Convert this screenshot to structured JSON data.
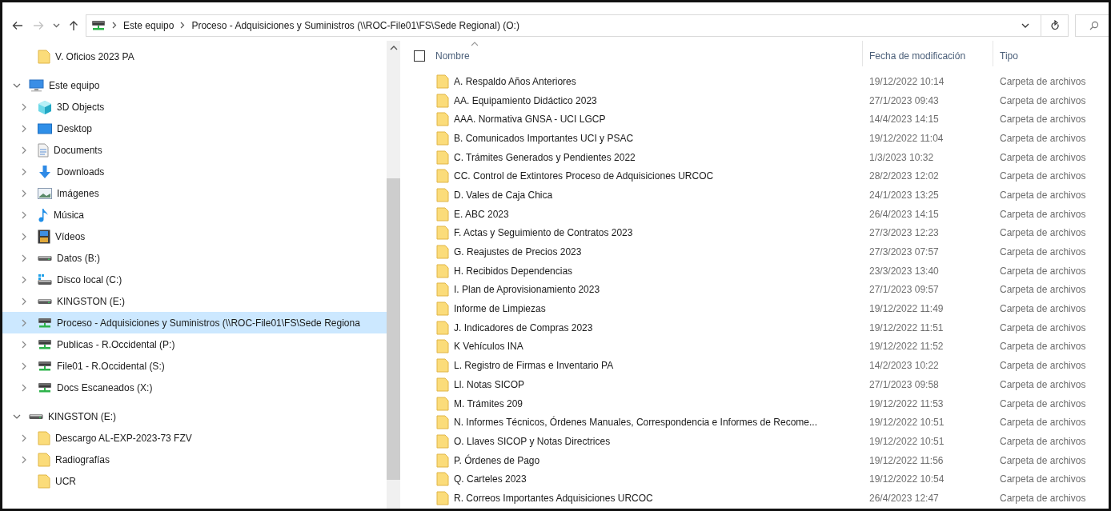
{
  "nav_buttons": [
    {
      "kind": "back",
      "disabled": false
    },
    {
      "kind": "forward",
      "disabled": true
    },
    {
      "kind": "recent",
      "disabled": false
    },
    {
      "kind": "up",
      "disabled": false
    }
  ],
  "address": {
    "crumbs": [
      "Este equipo",
      "Proceso - Adquisiciones y Suministros (\\\\ROC-File01\\FS\\Sede Regional) (O:)"
    ]
  },
  "sidebar": {
    "quick_access_items": [
      {
        "label": "V. Oficios 2023 PA",
        "kind": "folder",
        "expandable": false,
        "selected": false
      }
    ],
    "tree": [
      {
        "label": "Este equipo",
        "kind": "computer",
        "expandable": true,
        "expanded": true,
        "selected": false,
        "children": [
          {
            "label": "3D Objects",
            "kind": "objects3d",
            "expandable": true,
            "expanded": false,
            "selected": false
          },
          {
            "label": "Desktop",
            "kind": "desktop",
            "expandable": true,
            "expanded": false,
            "selected": false
          },
          {
            "label": "Documents",
            "kind": "documents",
            "expandable": true,
            "expanded": false,
            "selected": false
          },
          {
            "label": "Downloads",
            "kind": "downloads",
            "expandable": true,
            "expanded": false,
            "selected": false
          },
          {
            "label": "Imágenes",
            "kind": "pictures",
            "expandable": true,
            "expanded": false,
            "selected": false
          },
          {
            "label": "Música",
            "kind": "music",
            "expandable": true,
            "expanded": false,
            "selected": false
          },
          {
            "label": "Vídeos",
            "kind": "videos",
            "expandable": true,
            "expanded": false,
            "selected": false
          },
          {
            "label": "Datos (B:)",
            "kind": "drive",
            "expandable": true,
            "expanded": false,
            "selected": false
          },
          {
            "label": "Disco local (C:)",
            "kind": "system-drive",
            "expandable": true,
            "expanded": false,
            "selected": false
          },
          {
            "label": "KINGSTON (E:)",
            "kind": "drive",
            "expandable": true,
            "expanded": false,
            "selected": false
          },
          {
            "label": "Proceso - Adquisiciones y Suministros (\\\\ROC-File01\\FS\\Sede Regiona",
            "kind": "network-drive",
            "expandable": true,
            "expanded": false,
            "selected": true
          },
          {
            "label": "Publicas - R.Occidental (P:)",
            "kind": "network-drive",
            "expandable": true,
            "expanded": false,
            "selected": false
          },
          {
            "label": "File01 - R.Occidental (S:)",
            "kind": "network-drive",
            "expandable": true,
            "expanded": false,
            "selected": false
          },
          {
            "label": "Docs Escaneados (X:)",
            "kind": "network-drive",
            "expandable": true,
            "expanded": false,
            "selected": false
          }
        ]
      },
      {
        "label": "KINGSTON (E:)",
        "kind": "drive",
        "expandable": true,
        "expanded": true,
        "selected": false,
        "children": [
          {
            "label": "Descargo AL-EXP-2023-73 FZV",
            "kind": "folder",
            "expandable": true,
            "expanded": false,
            "selected": false
          },
          {
            "label": "Radiografías",
            "kind": "folder",
            "expandable": true,
            "expanded": false,
            "selected": false
          },
          {
            "label": "UCR",
            "kind": "folder",
            "expandable": false,
            "selected": false
          }
        ]
      }
    ]
  },
  "table": {
    "select_all_checked": false,
    "columns": [
      {
        "label": "Nombre",
        "sorted": true
      },
      {
        "label": "Fecha de modificación",
        "sorted": false
      },
      {
        "label": "Tipo",
        "sorted": false
      }
    ],
    "rows": [
      {
        "name": "A. Respaldo Años Anteriores",
        "date": "19/12/2022 10:14",
        "type": "Carpeta de archivos"
      },
      {
        "name": "AA. Equipamiento Didáctico 2023",
        "date": "27/1/2023 09:43",
        "type": "Carpeta de archivos"
      },
      {
        "name": "AAA. Normativa GNSA - UCI LGCP",
        "date": "14/4/2023 14:15",
        "type": "Carpeta de archivos"
      },
      {
        "name": "B. Comunicados Importantes UCI y PSAC",
        "date": "19/12/2022 11:04",
        "type": "Carpeta de archivos"
      },
      {
        "name": "C. Trámites Generados y Pendientes 2022",
        "date": "1/3/2023 10:32",
        "type": "Carpeta de archivos"
      },
      {
        "name": "CC. Control de Extintores Proceso de Adquisiciones URCOC",
        "date": "28/2/2023 12:02",
        "type": "Carpeta de archivos"
      },
      {
        "name": "D. Vales de Caja Chica",
        "date": "24/1/2023 13:25",
        "type": "Carpeta de archivos"
      },
      {
        "name": "E. ABC 2023",
        "date": "26/4/2023 14:15",
        "type": "Carpeta de archivos"
      },
      {
        "name": "F. Actas y Seguimiento de Contratos 2023",
        "date": "27/3/2023 12:23",
        "type": "Carpeta de archivos"
      },
      {
        "name": "G. Reajustes de Precios 2023",
        "date": "27/3/2023 07:57",
        "type": "Carpeta de archivos"
      },
      {
        "name": "H. Recibidos Dependencias",
        "date": "23/3/2023 13:40",
        "type": "Carpeta de archivos"
      },
      {
        "name": "I. Plan de Aprovisionamiento 2023",
        "date": "27/1/2023 09:57",
        "type": "Carpeta de archivos"
      },
      {
        "name": "Informe de Limpiezas",
        "date": "19/12/2022 11:49",
        "type": "Carpeta de archivos"
      },
      {
        "name": "J. Indicadores de Compras 2023",
        "date": "19/12/2022 11:51",
        "type": "Carpeta de archivos"
      },
      {
        "name": "K Vehículos INA",
        "date": "19/12/2022 11:52",
        "type": "Carpeta de archivos"
      },
      {
        "name": "L. Registro de Firmas e Inventario PA",
        "date": "14/2/2023 10:22",
        "type": "Carpeta de archivos"
      },
      {
        "name": "Ll. Notas SICOP",
        "date": "27/1/2023 09:58",
        "type": "Carpeta de archivos"
      },
      {
        "name": "M. Trámites 209",
        "date": "19/12/2022 11:53",
        "type": "Carpeta de archivos"
      },
      {
        "name": "N. Informes Técnicos, Órdenes Manuales, Correspondencia e Informes de Recome...",
        "date": "19/12/2022 10:51",
        "type": "Carpeta de archivos"
      },
      {
        "name": "O. Llaves SICOP y Notas Directrices",
        "date": "19/12/2022 10:51",
        "type": "Carpeta de archivos"
      },
      {
        "name": "P. Órdenes de Pago",
        "date": "19/12/2022 11:56",
        "type": "Carpeta de archivos"
      },
      {
        "name": "Q. Carteles 2023",
        "date": "19/12/2022 10:54",
        "type": "Carpeta de archivos"
      },
      {
        "name": "R. Correos Importantes Adquisiciones URCOC",
        "date": "26/4/2023 12:47",
        "type": "Carpeta de archivos"
      }
    ]
  }
}
